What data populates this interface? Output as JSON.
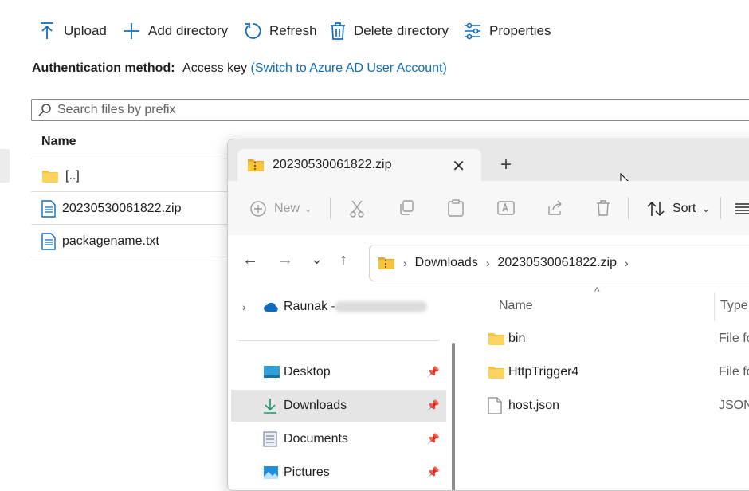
{
  "toolbar": {
    "upload": "Upload",
    "add_directory": "Add directory",
    "refresh": "Refresh",
    "delete_directory": "Delete directory",
    "properties": "Properties"
  },
  "auth": {
    "label": "Authentication method:",
    "value": "Access key",
    "switch_link": "(Switch to Azure AD User Account)"
  },
  "search": {
    "placeholder": "Search files by prefix"
  },
  "table": {
    "column_name": "Name",
    "rows": [
      "[..]",
      "20230530061822.zip",
      "packagename.txt"
    ]
  },
  "explorer": {
    "tab_title": "20230530061822.zip",
    "commands": {
      "new": "New",
      "sort": "Sort"
    },
    "breadcrumb": [
      "Downloads",
      "20230530061822.zip"
    ],
    "nav_items": [
      {
        "label": "Raunak -"
      },
      {
        "label": "Desktop"
      },
      {
        "label": "Downloads"
      },
      {
        "label": "Documents"
      },
      {
        "label": "Pictures"
      }
    ],
    "columns": {
      "name": "Name",
      "type": "Type"
    },
    "files": [
      {
        "name": "bin",
        "type": "File fo"
      },
      {
        "name": "HttpTrigger4",
        "type": "File fo"
      },
      {
        "name": "host.json",
        "type": "JSON"
      }
    ]
  },
  "colors": {
    "accent": "#0f6cbd",
    "folder": "#f8c53a"
  }
}
